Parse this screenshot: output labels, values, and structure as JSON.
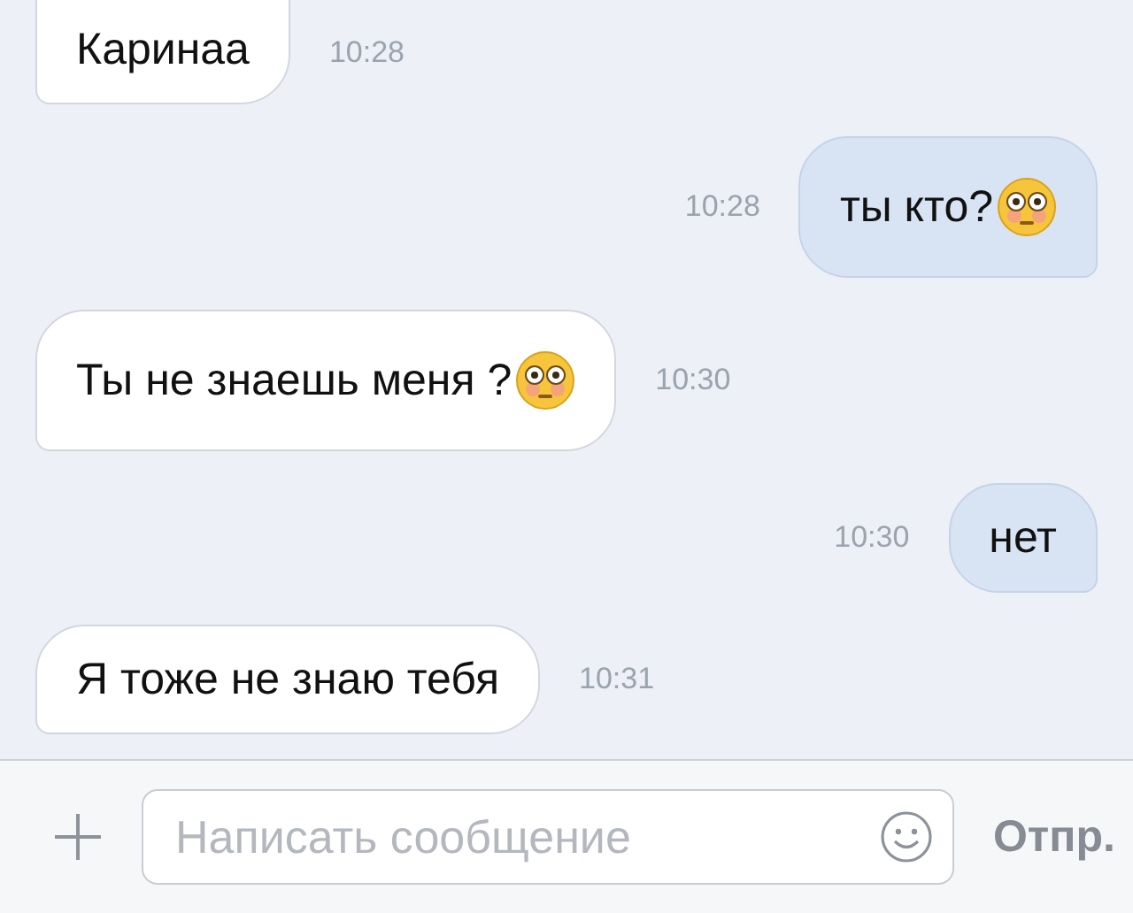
{
  "messages": [
    {
      "kind": "incoming",
      "text": "Каринаа",
      "time": "10:28",
      "emoji": false
    },
    {
      "kind": "outgoing",
      "text": "ты кто?",
      "time": "10:28",
      "emoji": true
    },
    {
      "kind": "incoming",
      "text": "Ты не знаешь меня ?",
      "time": "10:30",
      "emoji": true
    },
    {
      "kind": "outgoing",
      "text": "нет",
      "time": "10:30",
      "emoji": false
    },
    {
      "kind": "incoming",
      "text": "Я тоже не знаю тебя",
      "time": "10:31",
      "emoji": false
    }
  ],
  "composer": {
    "placeholder": "Написать сообщение",
    "send_label": "Отпр."
  }
}
